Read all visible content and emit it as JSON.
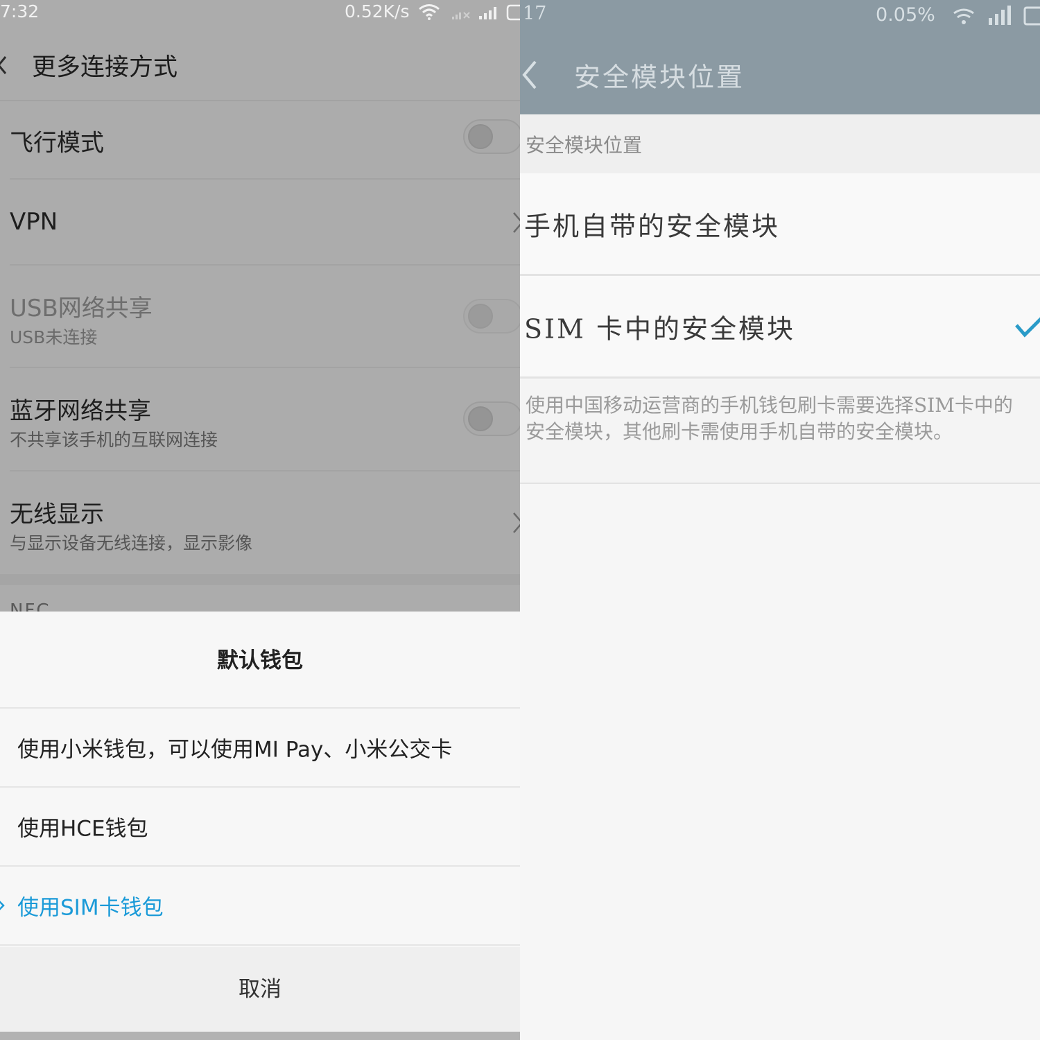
{
  "left": {
    "status_bar": {
      "time": "7:32",
      "net_speed": "0.52K/s"
    },
    "header": {
      "title": "更多连接方式"
    },
    "rows": [
      {
        "title": "飞行模式",
        "control": "toggle",
        "enabled": true,
        "on": false
      },
      {
        "title": "VPN",
        "control": "chevron"
      },
      {
        "title": "USB网络共享",
        "subtitle": "USB未连接",
        "control": "toggle",
        "enabled": false,
        "on": false
      },
      {
        "title": "蓝牙网络共享",
        "subtitle": "不共享该手机的互联网连接",
        "control": "toggle",
        "enabled": true,
        "on": false
      },
      {
        "title": "无线显示",
        "subtitle": "与显示设备无线连接，显示影像",
        "control": "chevron"
      }
    ],
    "section_peek": "NFC",
    "sheet": {
      "title": "默认钱包",
      "options": [
        {
          "label": "使用小米钱包，可以使用MI Pay、小米公交卡",
          "selected": false
        },
        {
          "label": "使用HCE钱包",
          "selected": false
        },
        {
          "label": "使用SIM卡钱包",
          "selected": true
        }
      ],
      "cancel_label": "取消"
    },
    "colors": {
      "accent": "#1a9ad8",
      "dim_overlay": "#acacac"
    }
  },
  "right": {
    "status_bar": {
      "time": "17",
      "percent": "0.05%"
    },
    "header": {
      "title": "安全模块位置"
    },
    "section_label": "安全模块位置",
    "options": [
      {
        "label": "手机自带的安全模块",
        "selected": false
      },
      {
        "label": "SIM 卡中的安全模块",
        "selected": true
      }
    ],
    "description": "使用中国移动运营商的手机钱包刷卡需要选择SIM卡中的安全模块，其他刷卡需使用手机自带的安全模块。",
    "colors": {
      "header_bg": "#8b9aa3",
      "check": "#2a9bc8"
    }
  }
}
